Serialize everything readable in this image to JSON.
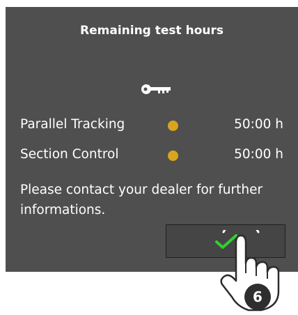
{
  "dialog": {
    "title": "Remaining test hours",
    "key_icon": "key-icon",
    "licenses": [
      {
        "name": "Parallel Tracking",
        "status_color": "#d9a51e",
        "hours": "50:00 h"
      },
      {
        "name": "Section Control",
        "status_color": "#d9a51e",
        "hours": "50:00 h"
      }
    ],
    "message": "Please contact your dealer for further informations.",
    "ok_button": {
      "icon": "check-icon",
      "icon_color": "#2fd12f"
    }
  },
  "annotation": {
    "hand_icon": "pointing-hand-icon",
    "step_number": "6"
  },
  "colors": {
    "dialog_background": "#4f4f4f",
    "button_background": "#454545",
    "text": "#ffffff"
  }
}
